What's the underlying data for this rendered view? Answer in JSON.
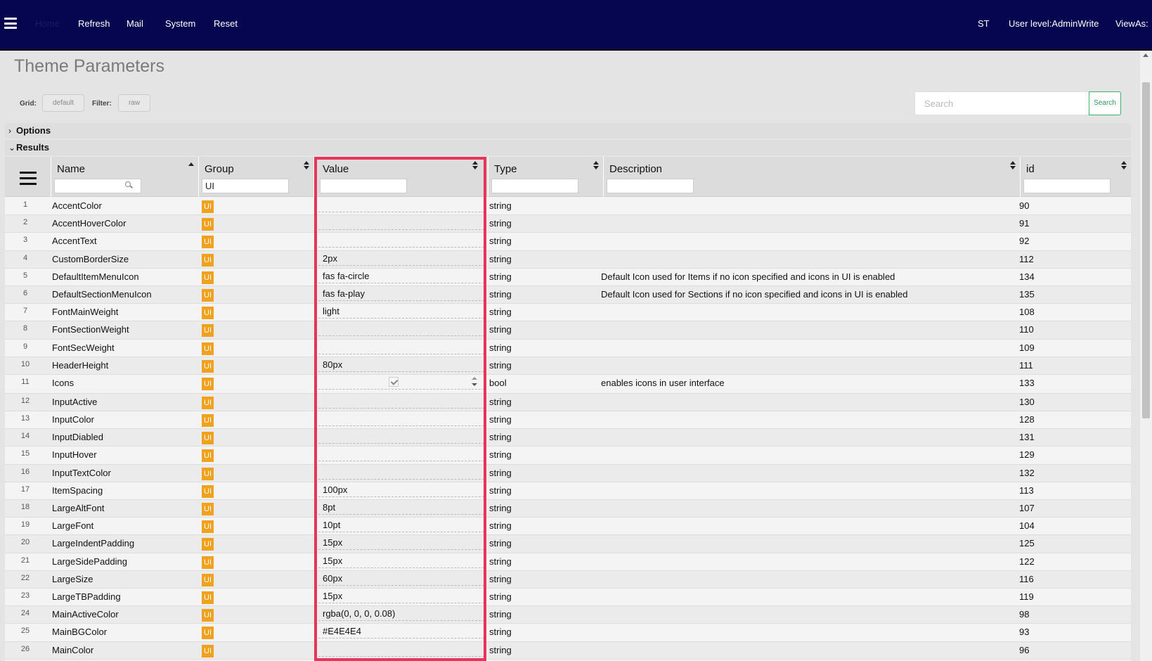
{
  "nav": {
    "home": "Home",
    "items": [
      "Refresh",
      "Mail",
      "System",
      "Reset"
    ],
    "right": [
      "ST",
      "User level:AdminWrite",
      "ViewAs:"
    ]
  },
  "page": {
    "title": "Theme Parameters"
  },
  "toolbar": {
    "grid_label": "Grid:",
    "grid_value": "default",
    "filter_label": "Filter:",
    "filter_value": "raw",
    "search_placeholder": "Search",
    "search_button": "Search"
  },
  "sections": {
    "options": "Options",
    "results": "Results"
  },
  "grid": {
    "columns": [
      "Name",
      "Group",
      "Value",
      "Type",
      "Description",
      "id"
    ],
    "filters": {
      "name": "",
      "group": "UI",
      "value": "",
      "type": "",
      "description": "",
      "id": ""
    },
    "rows": [
      {
        "n": "1",
        "name": "AccentColor",
        "group": "UI",
        "value": "",
        "type": "string",
        "desc": "",
        "id": "90"
      },
      {
        "n": "2",
        "name": "AccentHoverColor",
        "group": "UI",
        "value": "",
        "type": "string",
        "desc": "",
        "id": "91"
      },
      {
        "n": "3",
        "name": "AccentText",
        "group": "UI",
        "value": "",
        "type": "string",
        "desc": "",
        "id": "92"
      },
      {
        "n": "4",
        "name": "CustomBorderSize",
        "group": "UI",
        "value": "2px",
        "type": "string",
        "desc": "",
        "id": "112"
      },
      {
        "n": "5",
        "name": "DefaultItemMenuIcon",
        "group": "UI",
        "value": "fas fa-circle",
        "type": "string",
        "desc": "Default Icon used for Items if no icon specified and icons in UI is enabled",
        "id": "134"
      },
      {
        "n": "6",
        "name": "DefaultSectionMenuIcon",
        "group": "UI",
        "value": "fas fa-play",
        "type": "string",
        "desc": "Default Icon used for Sections if no icon specified and icons in UI is enabled",
        "id": "135"
      },
      {
        "n": "7",
        "name": "FontMainWeight",
        "group": "UI",
        "value": "light",
        "type": "string",
        "desc": "",
        "id": "108"
      },
      {
        "n": "8",
        "name": "FontSectionWeight",
        "group": "UI",
        "value": "",
        "type": "string",
        "desc": "",
        "id": "110"
      },
      {
        "n": "9",
        "name": "FontSecWeight",
        "group": "UI",
        "value": "",
        "type": "string",
        "desc": "",
        "id": "109"
      },
      {
        "n": "10",
        "name": "HeaderHeight",
        "group": "UI",
        "value": "80px",
        "type": "string",
        "desc": "",
        "id": "111"
      },
      {
        "n": "11",
        "name": "Icons",
        "group": "UI",
        "value": "",
        "type": "bool",
        "desc": "enables icons in user interface",
        "id": "133",
        "checkbox": true
      },
      {
        "n": "12",
        "name": "InputActive",
        "group": "UI",
        "value": "",
        "type": "string",
        "desc": "",
        "id": "130"
      },
      {
        "n": "13",
        "name": "InputColor",
        "group": "UI",
        "value": "",
        "type": "string",
        "desc": "",
        "id": "128"
      },
      {
        "n": "14",
        "name": "InputDiabled",
        "group": "UI",
        "value": "",
        "type": "string",
        "desc": "",
        "id": "131"
      },
      {
        "n": "15",
        "name": "InputHover",
        "group": "UI",
        "value": "",
        "type": "string",
        "desc": "",
        "id": "129"
      },
      {
        "n": "16",
        "name": "InputTextColor",
        "group": "UI",
        "value": "",
        "type": "string",
        "desc": "",
        "id": "132"
      },
      {
        "n": "17",
        "name": "ItemSpacing",
        "group": "UI",
        "value": "100px",
        "type": "string",
        "desc": "",
        "id": "113"
      },
      {
        "n": "18",
        "name": "LargeAltFont",
        "group": "UI",
        "value": "8pt",
        "type": "string",
        "desc": "",
        "id": "107"
      },
      {
        "n": "19",
        "name": "LargeFont",
        "group": "UI",
        "value": "10pt",
        "type": "string",
        "desc": "",
        "id": "104"
      },
      {
        "n": "20",
        "name": "LargeIndentPadding",
        "group": "UI",
        "value": "15px",
        "type": "string",
        "desc": "",
        "id": "125"
      },
      {
        "n": "21",
        "name": "LargeSidePadding",
        "group": "UI",
        "value": "15px",
        "type": "string",
        "desc": "",
        "id": "122"
      },
      {
        "n": "22",
        "name": "LargeSize",
        "group": "UI",
        "value": "60px",
        "type": "string",
        "desc": "",
        "id": "116"
      },
      {
        "n": "23",
        "name": "LargeTBPadding",
        "group": "UI",
        "value": "15px",
        "type": "string",
        "desc": "",
        "id": "119"
      },
      {
        "n": "24",
        "name": "MainActiveColor",
        "group": "UI",
        "value": "rgba(0, 0, 0, 0.08)",
        "type": "string",
        "desc": "",
        "id": "98"
      },
      {
        "n": "25",
        "name": "MainBGColor",
        "group": "UI",
        "value": "#E4E4E4",
        "type": "string",
        "desc": "",
        "id": "93"
      },
      {
        "n": "26",
        "name": "MainColor",
        "group": "UI",
        "value": "",
        "type": "string",
        "desc": "",
        "id": "96"
      }
    ]
  },
  "colors": {
    "nav_bg": "#05064f",
    "group_badge": "#f0a11e",
    "highlight": "#e8335a",
    "search_button": "#2a9a5a"
  }
}
